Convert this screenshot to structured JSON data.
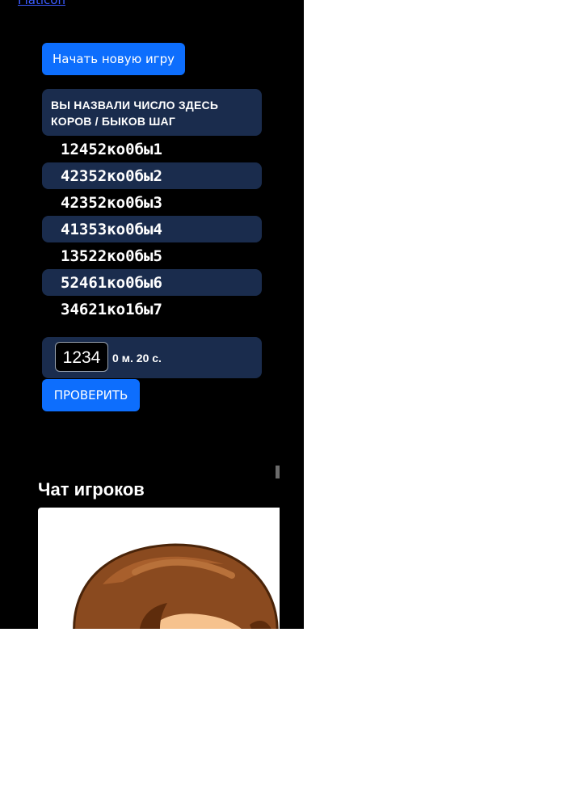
{
  "top_link": "Flaticon",
  "buttons": {
    "new_game": "Начать новую игру",
    "check": "ПРОВЕРИТЬ"
  },
  "table": {
    "header_line1": "ВЫ НАЗВАЛИ ЧИСЛО ЗДЕСЬ",
    "header_line2": "КОРОВ / БЫКОВ ШАГ",
    "rows": [
      {
        "number": "1245",
        "cows": "2",
        "cow_label": "ко",
        "bulls": "0",
        "bull_label": "бы",
        "step": "1"
      },
      {
        "number": "4235",
        "cows": "2",
        "cow_label": "ко",
        "bulls": "0",
        "bull_label": "бы",
        "step": "2"
      },
      {
        "number": "4235",
        "cows": "2",
        "cow_label": "ко",
        "bulls": "0",
        "bull_label": "бы",
        "step": "3"
      },
      {
        "number": "4135",
        "cows": "3",
        "cow_label": "ко",
        "bulls": "0",
        "bull_label": "бы",
        "step": "4"
      },
      {
        "number": "1352",
        "cows": "2",
        "cow_label": "ко",
        "bulls": "0",
        "bull_label": "бы",
        "step": "5"
      },
      {
        "number": "5246",
        "cows": "1",
        "cow_label": "ко",
        "bulls": "0",
        "bull_label": "бы",
        "step": "6"
      },
      {
        "number": "3462",
        "cows": "1",
        "cow_label": "ко",
        "bulls": "1",
        "bull_label": "бы",
        "step": "7"
      }
    ]
  },
  "guess": {
    "value": "1234",
    "timer": "0 м. 20 с."
  },
  "chat": {
    "title": "Чат игроков",
    "avatar_icon": "cartoon-avatar-icon"
  },
  "colors": {
    "panel_bg": "#000000",
    "accent": "#0d6efd",
    "row_dark": "#1a2c4d",
    "link": "#3b5bff"
  }
}
